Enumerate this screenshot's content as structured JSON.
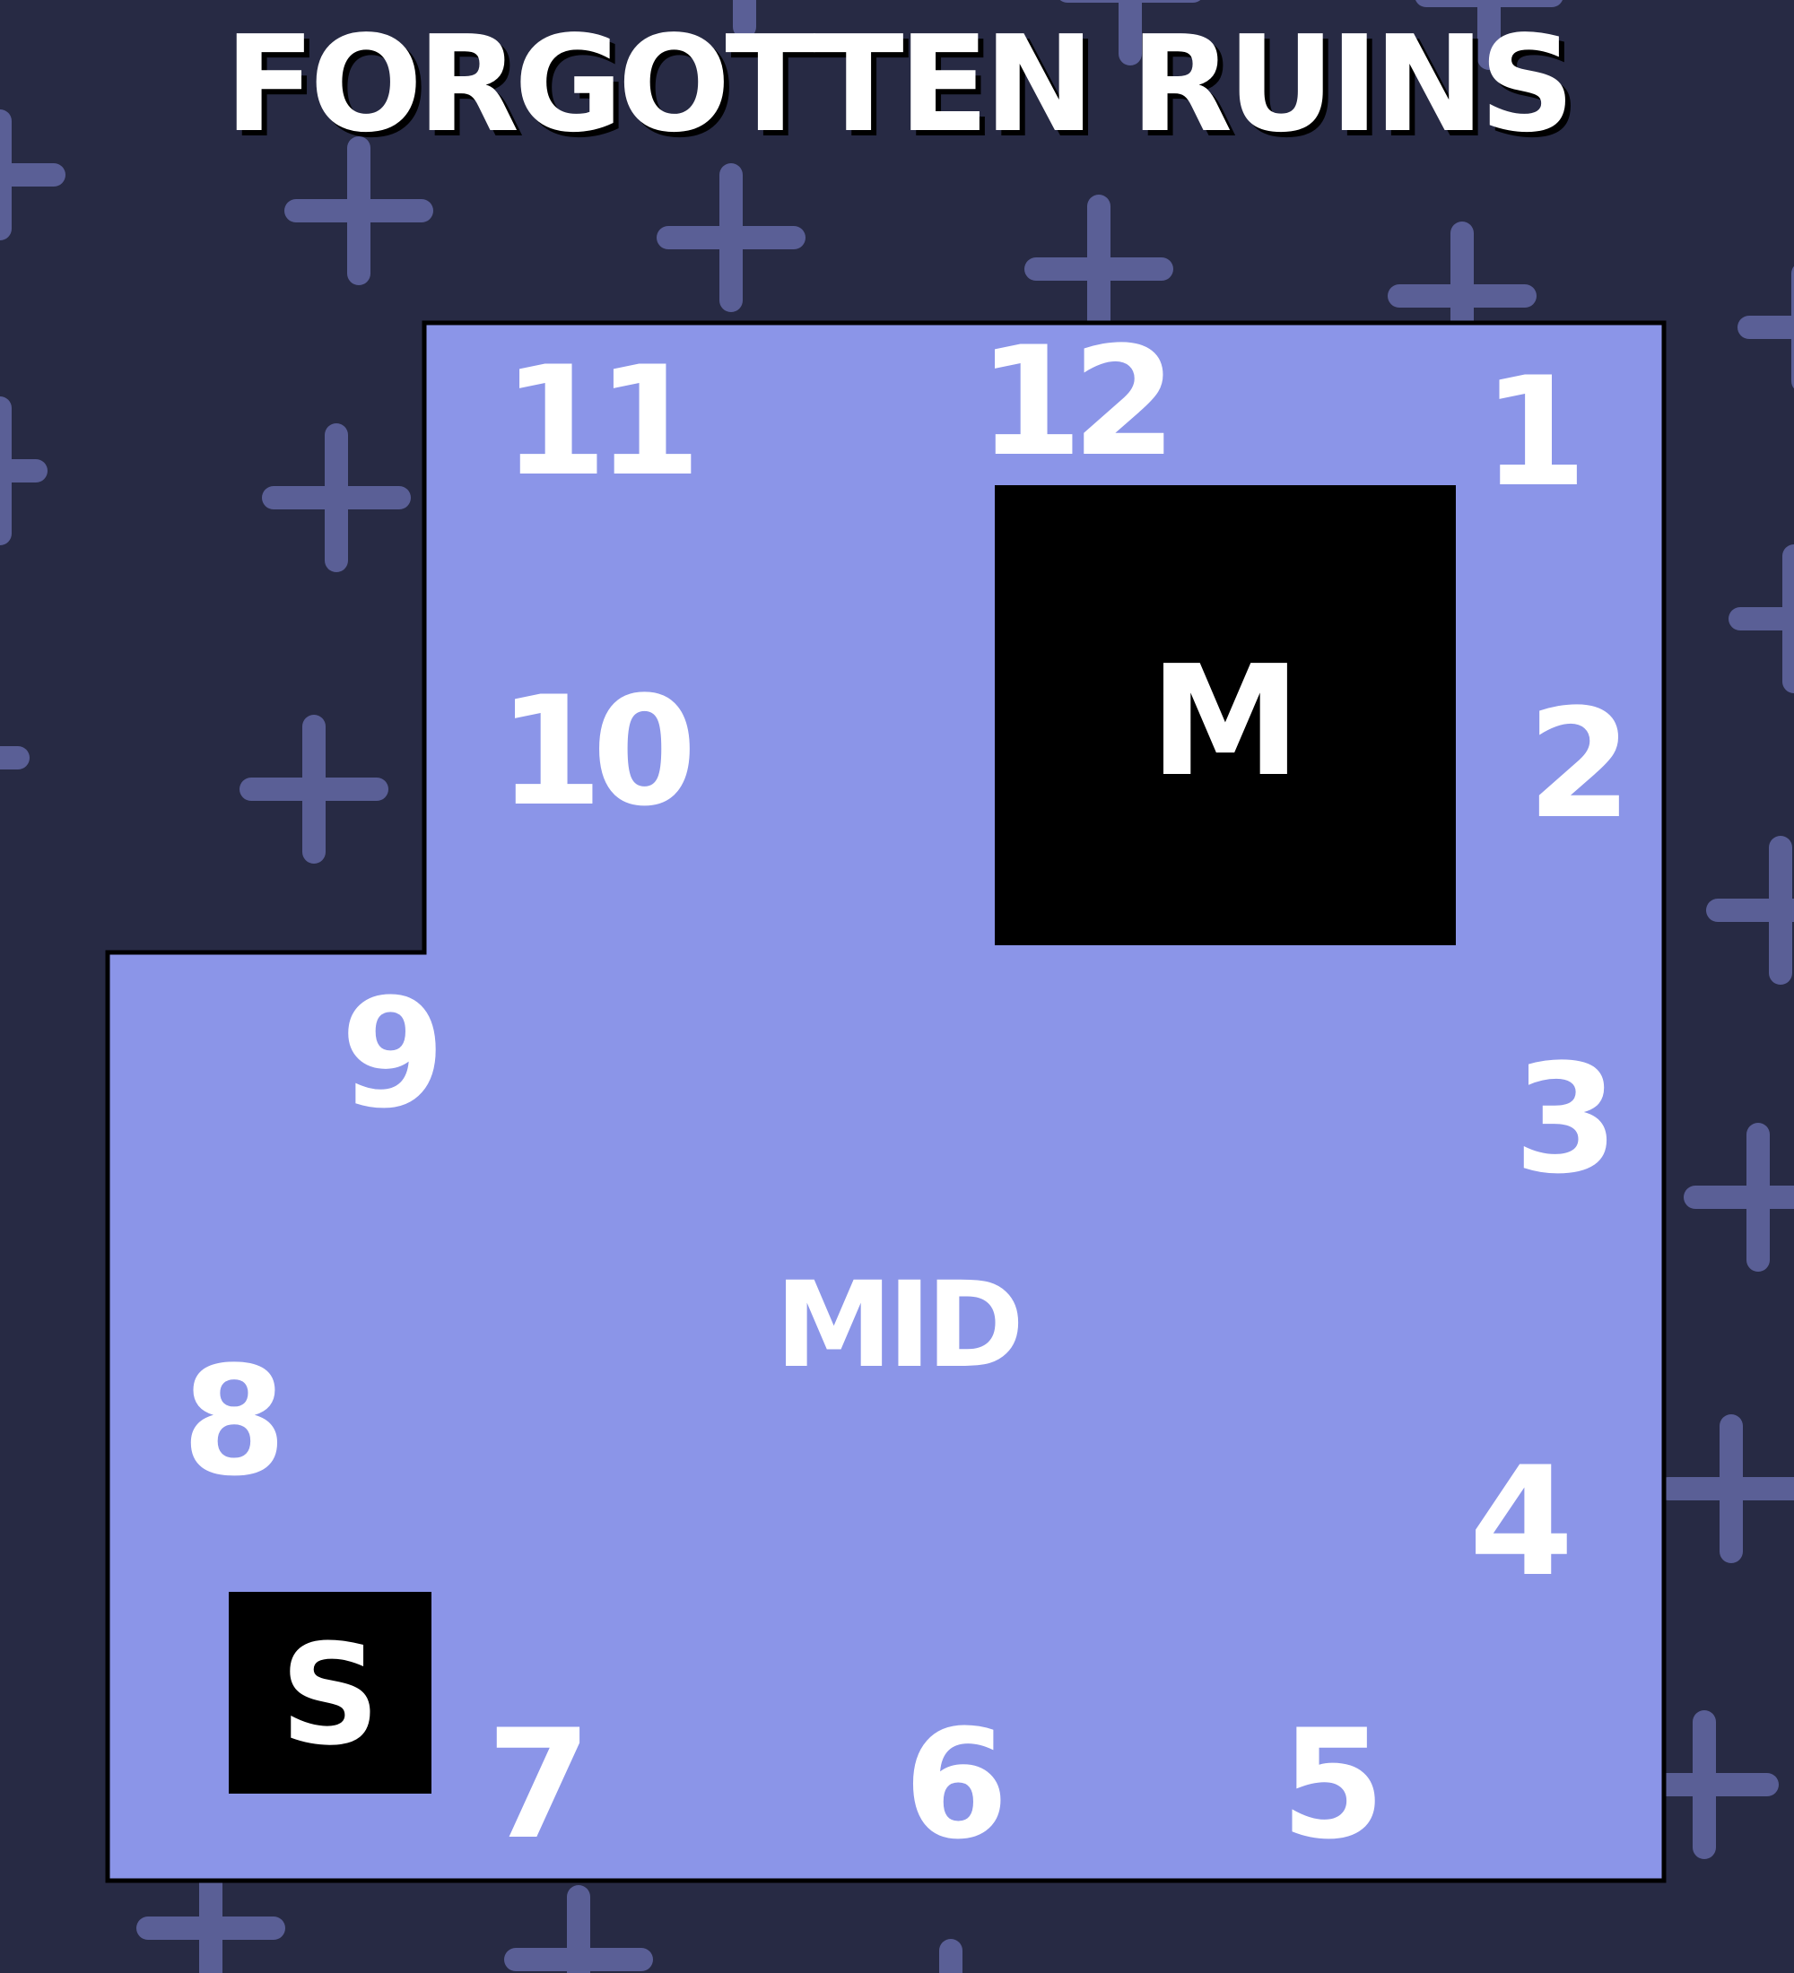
{
  "map": {
    "title": "FORGOTTEN RUINS",
    "center_label": "MID",
    "positions": [
      "1",
      "2",
      "3",
      "4",
      "5",
      "6",
      "7",
      "8",
      "9",
      "10",
      "11",
      "12"
    ],
    "spawn_label": "S",
    "m_label": "M"
  },
  "colors": {
    "background": "#272a44",
    "plus_pattern": "#5a5f96",
    "arena_fill": "#8b95e8",
    "arena_outline": "#000000",
    "block": "#000000",
    "text": "#ffffff"
  }
}
